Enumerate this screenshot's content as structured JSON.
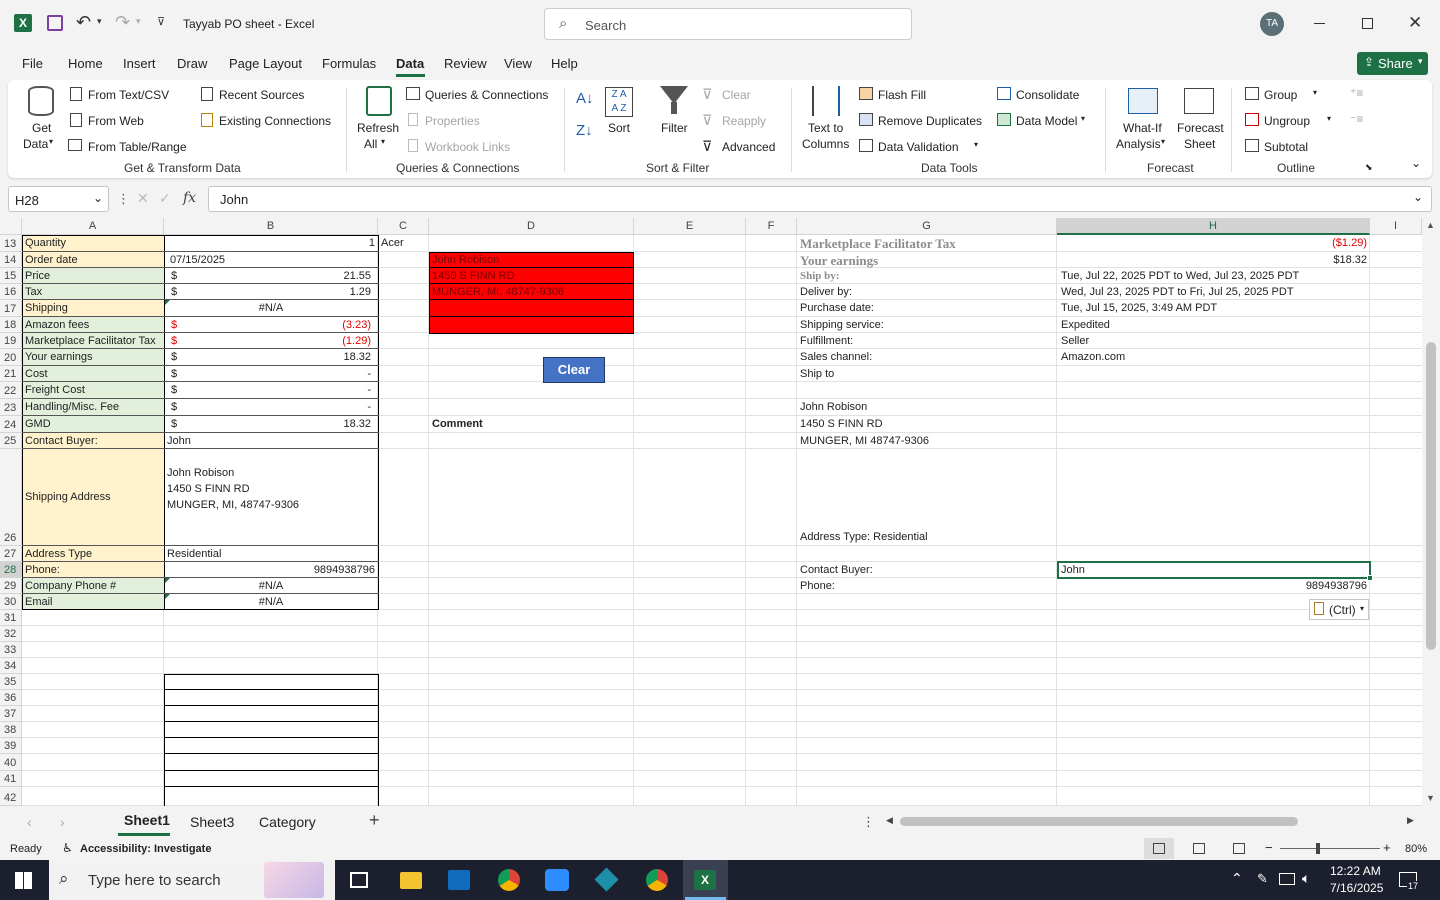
{
  "window": {
    "title": "Tayyab PO sheet  -  Excel",
    "search_placeholder": "Search",
    "avatar": "TA"
  },
  "menu": [
    "File",
    "Home",
    "Insert",
    "Draw",
    "Page Layout",
    "Formulas",
    "Data",
    "Review",
    "View",
    "Help"
  ],
  "active_menu": "Data",
  "share_label": "Share",
  "ribbon": {
    "get_data": "Get",
    "get_data2": "Data",
    "from_text_csv": "From Text/CSV",
    "from_web": "From Web",
    "from_table": "From Table/Range",
    "recent_sources": "Recent Sources",
    "existing_connections": "Existing Connections",
    "group_get": "Get & Transform Data",
    "refresh": "Refresh",
    "refresh2": "All",
    "queries_connections": "Queries & Connections",
    "properties": "Properties",
    "workbook_links": "Workbook Links",
    "group_queries": "Queries & Connections",
    "sort": "Sort",
    "filter": "Filter",
    "clear": "Clear",
    "reapply": "Reapply",
    "advanced": "Advanced",
    "group_sort": "Sort & Filter",
    "text_to_columns": "Text to",
    "text_to_columns2": "Columns",
    "flash_fill": "Flash Fill",
    "remove_duplicates": "Remove Duplicates",
    "data_validation": "Data Validation",
    "consolidate": "Consolidate",
    "data_model": "Data Model",
    "group_tools": "Data Tools",
    "what_if": "What-If",
    "what_if2": "Analysis",
    "forecast_sheet": "Forecast",
    "forecast_sheet2": "Sheet",
    "group_forecast": "Forecast",
    "group": "Group",
    "ungroup": "Ungroup",
    "subtotal": "Subtotal",
    "group_outline": "Outline"
  },
  "formula_bar": {
    "name_box": "H28",
    "fx": "fx",
    "value": "John"
  },
  "columns": [
    "A",
    "B",
    "C",
    "D",
    "E",
    "F",
    "G",
    "H",
    "I"
  ],
  "rows": [
    "13",
    "14",
    "15",
    "16",
    "17",
    "18",
    "19",
    "20",
    "21",
    "22",
    "23",
    "24",
    "25",
    "26",
    "27",
    "28",
    "29",
    "30",
    "31",
    "32",
    "33",
    "34",
    "35",
    "36",
    "37",
    "38",
    "39",
    "40",
    "41",
    "42"
  ],
  "cells": {
    "a13": "Quantity",
    "a14": "Order date",
    "a15": "Price",
    "a16": "Tax",
    "a17": "Shipping",
    "a18": "Amazon fees",
    "a19": "Marketplace Facilitator Tax",
    "a20": "Your earnings",
    "a21": "Cost",
    "a22": "Freight Cost",
    "a23": "Handling/Misc. Fee",
    "a24": "GMD",
    "a25": "Contact Buyer:",
    "a26": "Shipping Address",
    "a27": "Address Type",
    "a28": "Phone:",
    "a29": "Company Phone #",
    "a30": "Email",
    "b13": "1",
    "b14": "07/15/2025",
    "b15_cur": "$",
    "b15": "21.55",
    "b16_cur": "$",
    "b16": "1.29",
    "b17": "#N/A",
    "b18_cur": "$",
    "b18": "(3.23)",
    "b19_cur": "$",
    "b19": "(1.29)",
    "b20_cur": "$",
    "b20": "18.32",
    "b21_cur": "$",
    "b21": "-",
    "b22_cur": "$",
    "b22": "-",
    "b23_cur": "$",
    "b23": "-",
    "b24_cur": "$",
    "b24": "18.32",
    "b25": "John",
    "b26_1": "John Robison",
    "b26_2": "1450 S FINN RD",
    "b26_3": "MUNGER, MI, 48747-9306",
    "b27": "Residential",
    "b28": "9894938796",
    "b29": "#N/A",
    "b30": "#N/A",
    "c13": "Acer",
    "d14": "John Robison",
    "d15": "1450 S FINN RD",
    "d16": "MUNGER, MI, 48747-9306",
    "d24": "Comment",
    "clear_button": "Clear",
    "g13": "Marketplace Facilitator Tax",
    "g14": "Your earnings",
    "g15": "Ship by:",
    "g16": "Deliver by:",
    "g17": "Purchase date:",
    "g18": "Shipping service:",
    "g19": "Fulfillment:",
    "g20": "Sales channel:",
    "g21": "Ship to",
    "g23": "John Robison",
    "g24": "1450 S FINN RD",
    "g25": "MUNGER, MI 48747-9306",
    "g26": "Address Type:  Residential",
    "g28": "Contact Buyer:",
    "g29": "Phone:",
    "h13": "($1.29)",
    "h14": "$18.32",
    "h15": "Tue, Jul 22, 2025 PDT to Wed, Jul 23, 2025 PDT",
    "h16": "Wed, Jul 23, 2025 PDT to Fri, Jul 25, 2025 PDT",
    "h17": "Tue, Jul 15, 2025, 3:49 AM PDT",
    "h18": "Expedited",
    "h19": "Seller",
    "h20": "Amazon.com",
    "h28": "John",
    "h29": "9894938796",
    "paste_ctrl": "(Ctrl)"
  },
  "sheets": [
    "Sheet1",
    "Sheet3",
    "Category"
  ],
  "active_sheet": "Sheet1",
  "status": {
    "ready": "Ready",
    "accessibility": "Accessibility: Investigate",
    "zoom": "80%"
  },
  "taskbar": {
    "search_placeholder": "Type here to search",
    "time": "12:22 AM",
    "date": "7/16/2025",
    "notifications": "17"
  },
  "colors": {
    "excel_green": "#1e7145",
    "header_fill": "#e2efda",
    "label_fill": "#fff2cc",
    "red_fill": "#ff0000",
    "clear_button": "#4472c4"
  }
}
